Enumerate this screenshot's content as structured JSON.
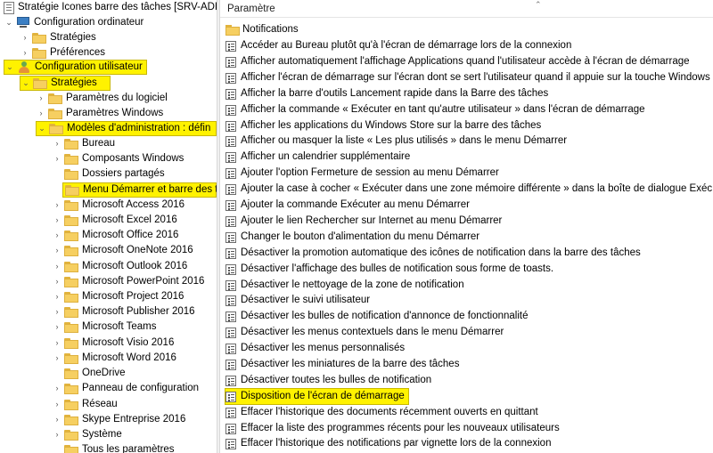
{
  "tree": {
    "root_title": "Stratégie Icones barre des tâches [SRV-ADDS",
    "items": [
      {
        "label": "Configuration ordinateur"
      },
      {
        "label": "Stratégies"
      },
      {
        "label": "Préférences"
      },
      {
        "label": "Configuration utilisateur"
      },
      {
        "label": "Stratégies"
      },
      {
        "label": "Paramètres du logiciel"
      },
      {
        "label": "Paramètres Windows"
      },
      {
        "label": "Modèles d'administration : défin"
      },
      {
        "label": "Bureau"
      },
      {
        "label": "Composants Windows"
      },
      {
        "label": "Dossiers partagés"
      },
      {
        "label": "Menu Démarrer et barre des t"
      },
      {
        "label": "Microsoft Access 2016"
      },
      {
        "label": "Microsoft Excel 2016"
      },
      {
        "label": "Microsoft Office 2016"
      },
      {
        "label": "Microsoft OneNote 2016"
      },
      {
        "label": "Microsoft Outlook 2016"
      },
      {
        "label": "Microsoft PowerPoint 2016"
      },
      {
        "label": "Microsoft Project 2016"
      },
      {
        "label": "Microsoft Publisher 2016"
      },
      {
        "label": "Microsoft Teams"
      },
      {
        "label": "Microsoft Visio 2016"
      },
      {
        "label": "Microsoft Word 2016"
      },
      {
        "label": "OneDrive"
      },
      {
        "label": "Panneau de configuration"
      },
      {
        "label": "Réseau"
      },
      {
        "label": "Skype Entreprise 2016"
      },
      {
        "label": "Système"
      },
      {
        "label": "Tous les paramètres"
      }
    ]
  },
  "list": {
    "header": "Paramètre",
    "folder_label": "Notifications",
    "settings": [
      "Accéder au Bureau plutôt qu'à l'écran de démarrage lors de la connexion",
      "Afficher automatiquement l'affichage Applications quand l'utilisateur accède à l'écran de démarrage",
      "Afficher l'écran de démarrage sur l'écran dont se sert l'utilisateur quand il appuie sur la touche Windows",
      "Afficher la barre d'outils Lancement rapide dans la Barre des tâches",
      "Afficher la commande « Exécuter en tant qu'autre utilisateur » dans l'écran de démarrage",
      "Afficher les applications du Windows Store sur la barre des tâches",
      "Afficher ou masquer la liste « Les plus utilisés » dans le menu Démarrer",
      "Afficher un calendrier supplémentaire",
      "Ajouter l'option Fermeture de session au menu Démarrer",
      "Ajouter la case à cocher « Exécuter dans une zone mémoire différente » dans la boîte de dialogue Exéc...",
      "Ajouter la commande Exécuter au menu Démarrer",
      "Ajouter le lien Rechercher sur Internet au menu Démarrer",
      "Changer le bouton d'alimentation du menu Démarrer",
      "Désactiver la promotion automatique des icônes de notification dans la barre des tâches",
      "Désactiver l'affichage des bulles de notification sous forme de toasts.",
      "Désactiver le nettoyage de la zone de notification",
      "Désactiver le suivi utilisateur",
      "Désactiver les bulles de notification d'annonce de fonctionnalité",
      "Désactiver les menus contextuels dans le menu Démarrer",
      "Désactiver les menus personnalisés",
      "Désactiver les miniatures de la barre des tâches",
      "Désactiver toutes les bulles de notification",
      "Disposition de l'écran de démarrage",
      "Effacer l'historique des documents récemment ouverts en quittant",
      "Effacer la liste des programmes récents pour les nouveaux utilisateurs",
      "Effacer l'historique des notifications par vignette lors de la connexion"
    ]
  },
  "colors": {
    "highlight": "#fff200",
    "folder": "#f6cf61"
  }
}
